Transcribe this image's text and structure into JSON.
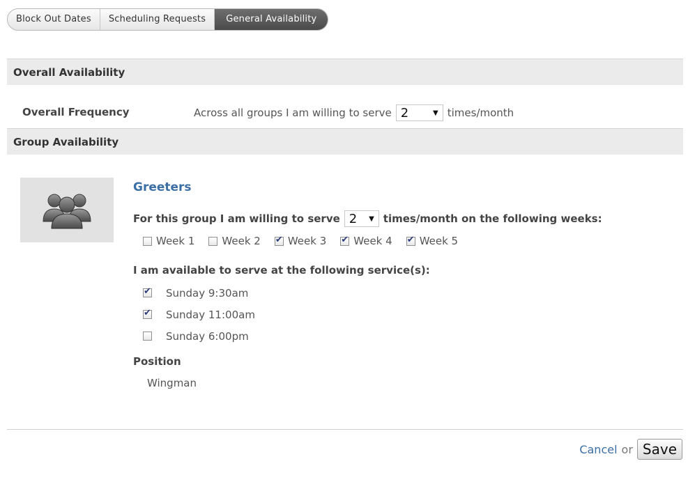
{
  "tabs": [
    {
      "label": "Block Out Dates",
      "active": false
    },
    {
      "label": "Scheduling Requests",
      "active": false
    },
    {
      "label": "General Availability",
      "active": true
    }
  ],
  "overall": {
    "section_title": "Overall Availability",
    "frequency_label": "Overall Frequency",
    "prefix": "Across all groups I am willing to serve",
    "times_value": "2",
    "suffix": "times/month"
  },
  "group_section": {
    "section_title": "Group Availability",
    "group": {
      "name": "Greeters",
      "icon": "group-people-icon",
      "serve_prefix": "For this group I am willing to serve",
      "times_value": "2",
      "serve_suffix": "times/month on the following weeks:",
      "weeks": [
        {
          "label": "Week 1",
          "checked": false
        },
        {
          "label": "Week 2",
          "checked": false
        },
        {
          "label": "Week 3",
          "checked": true
        },
        {
          "label": "Week 4",
          "checked": true
        },
        {
          "label": "Week 5",
          "checked": true
        }
      ],
      "services_label": "I am available to serve at the following service(s):",
      "services": [
        {
          "label": "Sunday 9:30am",
          "checked": true
        },
        {
          "label": "Sunday 11:00am",
          "checked": true
        },
        {
          "label": "Sunday 6:00pm",
          "checked": false
        }
      ],
      "position_label": "Position",
      "position_value": "Wingman"
    }
  },
  "footer": {
    "cancel_label": "Cancel",
    "or_text": "or",
    "save_label": "Save"
  },
  "colors": {
    "link": "#3a6ea5",
    "active_tab": "#555555",
    "section_bg": "#ebebeb"
  }
}
